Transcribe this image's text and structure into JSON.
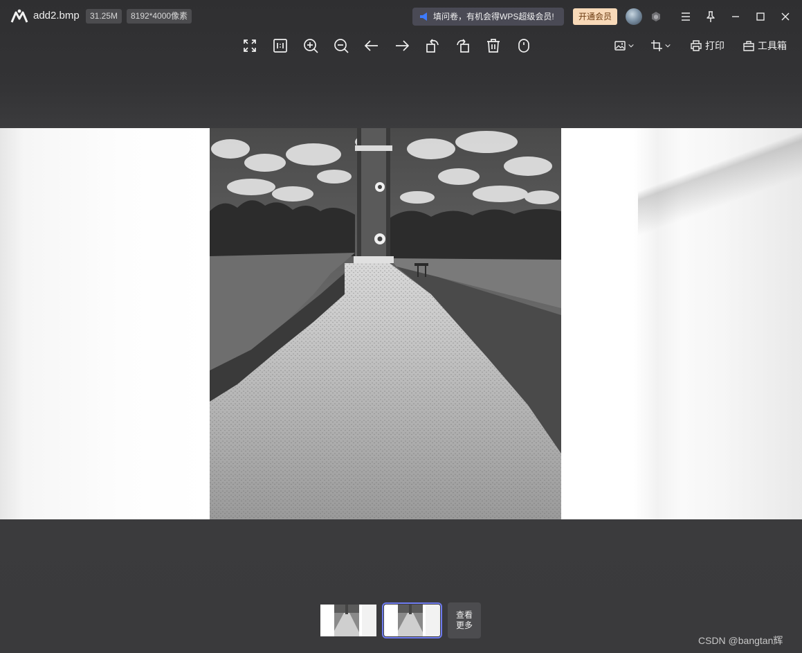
{
  "app": {
    "file_name": "add2.bmp",
    "file_size": "31.25M",
    "dimensions": "8192*4000像素",
    "promo_text": "填问卷，有机会得WPS超级会员!",
    "vip_button": "开通会员"
  },
  "toolbar": {
    "tools": [
      "fullscreen-icon",
      "actual-size-icon",
      "zoom-in-icon",
      "zoom-out-icon",
      "previous-icon",
      "next-icon",
      "rotate-left-icon",
      "rotate-right-icon",
      "delete-icon",
      "mouse-mode-icon"
    ],
    "print_label": "打印",
    "toolbox_label": "工具箱"
  },
  "thumbnails": {
    "more_line1": "查看",
    "more_line2": "更多"
  },
  "watermark": "CSDN @bangtan辉",
  "colors": {
    "accent": "#6f7cf0",
    "vip_bg": "#f8d9b8",
    "background": "#3a3a3c"
  }
}
